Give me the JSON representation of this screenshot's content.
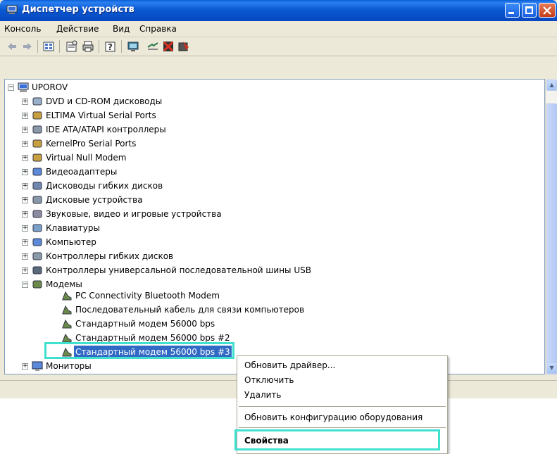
{
  "window": {
    "title": "Диспетчер устройств"
  },
  "menubar": {
    "items": [
      "Консоль",
      "Действие",
      "Вид",
      "Справка"
    ]
  },
  "toolbar": {
    "icons": [
      "back-arrow-icon",
      "forward-arrow-icon",
      "view-icon",
      "properties-icon",
      "print-icon",
      "help-icon",
      "scan-hardware-icon",
      "update-driver-icon",
      "disable-device-icon",
      "uninstall-device-icon"
    ]
  },
  "tree": {
    "root": "UPOROV",
    "categories": [
      "DVD и CD-ROM дисководы",
      "ELTIMA Virtual Serial Ports",
      "IDE ATA/ATAPI контроллеры",
      "KernelPro Serial Ports",
      "Virtual Null Modem",
      "Видеоадаптеры",
      "Дисководы гибких дисков",
      "Дисковые устройства",
      "Звуковые, видео и игровые устройства",
      "Клавиатуры",
      "Компьютер",
      "Контроллеры гибких дисков",
      "Контроллеры универсальной последовательной шины USB",
      "Модемы"
    ],
    "modems": [
      "PC Connectivity Bluetooth Modem",
      "Последовательный кабель для связи компьютеров",
      "Стандартный модем 56000 bps",
      "Стандартный модем 56000 bps #2",
      "Стандартный модем 56000 bps #3"
    ],
    "after": "Мониторы"
  },
  "context_menu": {
    "items": [
      "Обновить драйвер...",
      "Отключить",
      "Удалить",
      "Обновить конфигурацию оборудования",
      "Свойства"
    ]
  },
  "colors": {
    "title_blue": "#0a5ad2",
    "selection": "#316ac5",
    "highlight": "#3fe0d0"
  }
}
